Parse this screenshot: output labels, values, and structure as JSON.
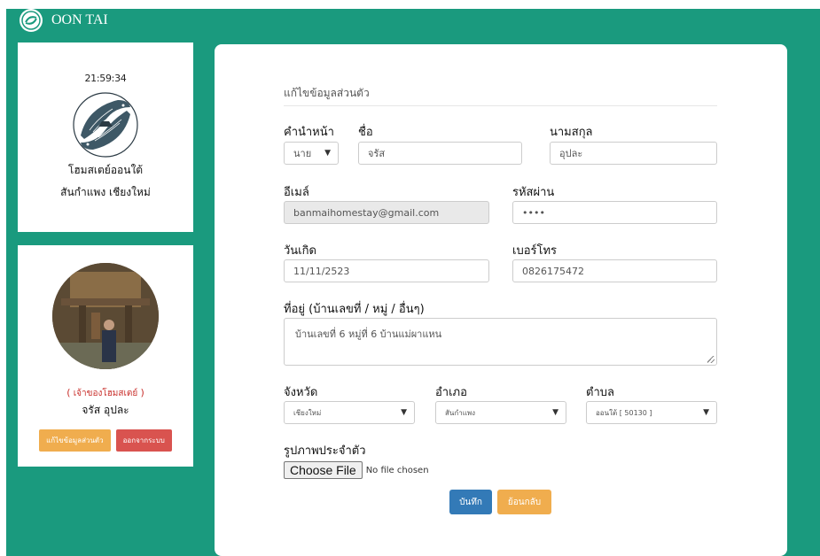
{
  "brand": {
    "name": "OON TAI"
  },
  "profile": {
    "clock": "21:59:34",
    "home_name": "โฮมสเตย์ออนใต้",
    "home_location": "สันกำแพง เชียงใหม่"
  },
  "user": {
    "role_open": "(",
    "role": "เจ้าของโฮมสเตย์",
    "role_close": ")",
    "name": "จรัส อุปละ",
    "edit_button": "แก้ไขข้อมูลส่วนตัว",
    "logout_button": "ออกจากระบบ"
  },
  "form": {
    "section_title": "แก้ไขข้อมูลส่วนตัว",
    "prefix_label": "คำนำหน้า",
    "prefix_value": "นาย",
    "firstname_label": "ชื่อ",
    "firstname_value": "จรัส",
    "lastname_label": "นามสกุล",
    "lastname_value": "อุปละ",
    "email_label": "อีเมล์",
    "email_value": "banmaihomestay@gmail.com",
    "password_label": "รหัสผ่าน",
    "password_value": "••••",
    "birthday_label": "วันเกิด",
    "birthday_value": "11/11/2523",
    "phone_label": "เบอร์โทร",
    "phone_value": "0826175472",
    "address_label": "ที่อยู่ (บ้านเลขที่ / หมู่ / อื่นๆ)",
    "address_value": "บ้านเลขที่ 6 หมู่ที่ 6 บ้านแม่ผาแหน",
    "province_label": "จังหวัด",
    "province_value": "เชียงใหม่",
    "district_label": "อำเภอ",
    "district_value": "สันกำแพง",
    "subdistrict_label": "ตำบล",
    "subdistrict_value": "ออนใต้ [ 50130 ]",
    "photo_label": "รูปภาพประจำตัว",
    "choose_file": "Choose File",
    "no_file": "No file chosen",
    "save_button": "บันทึก",
    "back_button": "ย้อนกลับ"
  },
  "colors": {
    "teal": "#1a9a7e",
    "primary": "#337ab7",
    "warning": "#f0ad4e",
    "danger": "#d9534f"
  }
}
